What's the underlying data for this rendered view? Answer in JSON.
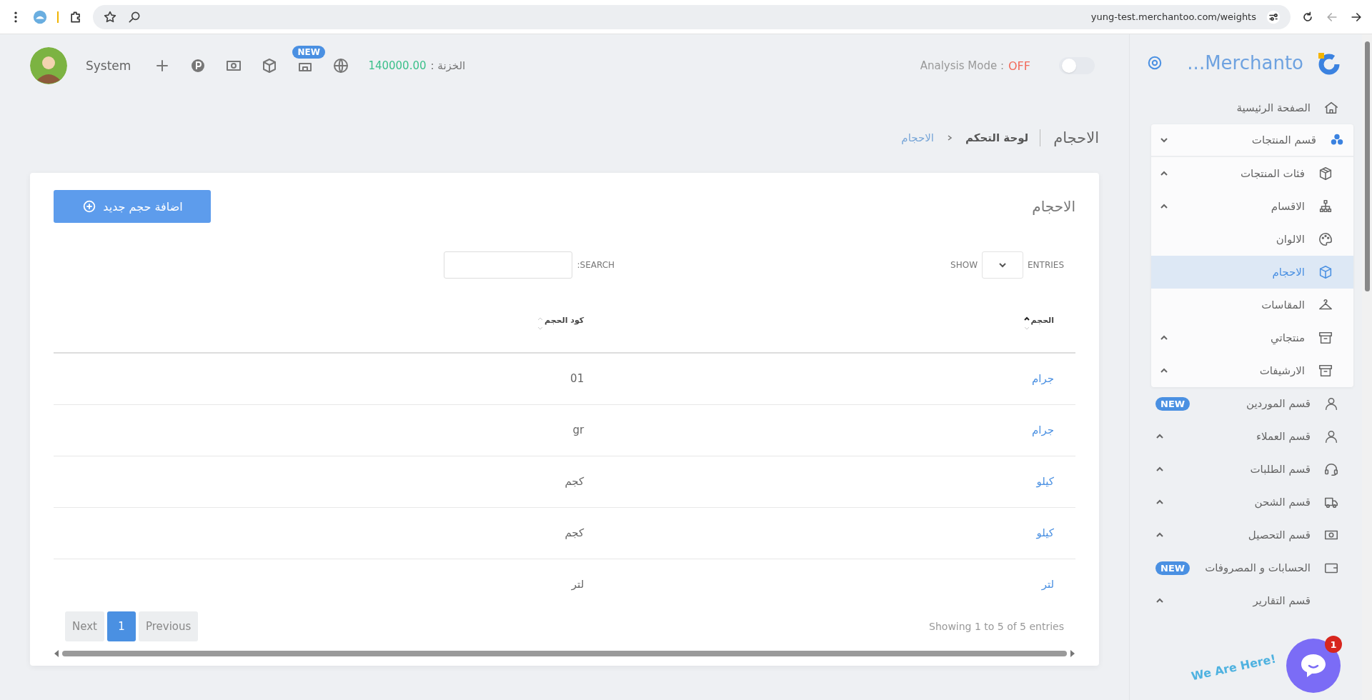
{
  "browser": {
    "url": "yung-test.merchantoo.com/weights"
  },
  "header": {
    "user_name": "System",
    "store_badge": "NEW",
    "treasury_label": "الخزنة :",
    "treasury_value": "140000.00",
    "analysis_label": "Analysis Mode :",
    "analysis_value": "OFF",
    "analysis_on": false
  },
  "sidebar": {
    "brand": "Merchanto...",
    "items": [
      {
        "kind": "link",
        "label": "الصفحة الرئيسية",
        "selected": false
      },
      {
        "kind": "group",
        "label": "قسم المنتجات",
        "expanded": true,
        "selected": false,
        "children": [
          {
            "kind": "group",
            "label": "فئات المنتجات",
            "expanded": false,
            "selected": false
          },
          {
            "kind": "group",
            "label": "الاقسام",
            "expanded": false,
            "selected": false
          },
          {
            "kind": "link",
            "label": "الالوان",
            "selected": false
          },
          {
            "kind": "link",
            "label": "الاحجام",
            "selected": true
          },
          {
            "kind": "link",
            "label": "المقاسات",
            "selected": false
          },
          {
            "kind": "group",
            "label": "منتجاتي",
            "expanded": false,
            "selected": false
          },
          {
            "kind": "group",
            "label": "الارشيفات",
            "expanded": false,
            "selected": false
          }
        ]
      },
      {
        "kind": "link",
        "label": "قسم الموردين",
        "badge": "NEW",
        "selected": false
      },
      {
        "kind": "group",
        "label": "قسم العملاء",
        "expanded": false,
        "selected": false
      },
      {
        "kind": "group",
        "label": "قسم الطلبات",
        "expanded": false,
        "selected": false
      },
      {
        "kind": "group",
        "label": "قسم الشحن",
        "expanded": false,
        "selected": false
      },
      {
        "kind": "group",
        "label": "قسم التحصيل",
        "expanded": false,
        "selected": false
      },
      {
        "kind": "link",
        "label": "الحسابات و المصروفات",
        "badge": "NEW",
        "selected": false
      },
      {
        "kind": "group",
        "label": "قسم التقارير",
        "expanded": false,
        "selected": false
      }
    ]
  },
  "breadcrumb": {
    "title": "الاحجام",
    "items": [
      {
        "label": "لوحة التحكم",
        "selected": false
      },
      {
        "label": "الاحجام",
        "selected": true
      }
    ]
  },
  "card": {
    "title": "الاحجام",
    "add_button": "اضافة حجم جديد",
    "show_label": "SHOW",
    "entries_label": "ENTRIES",
    "search_label": "SEARCH:",
    "table": {
      "columns": [
        {
          "label": "الحجم",
          "sorted": true
        },
        {
          "label": "كود الحجم",
          "sorted": false
        }
      ],
      "rows": [
        [
          "جرام",
          "01"
        ],
        [
          "جرام",
          "gr"
        ],
        [
          "كيلو",
          "كجم"
        ],
        [
          "كيلو",
          "كجم"
        ],
        [
          "لتر",
          "لتر"
        ]
      ]
    },
    "info": "Showing 1 to 5 of 5 entries",
    "pages": [
      {
        "label": "Previous",
        "selected": false
      },
      {
        "label": "1",
        "selected": true
      },
      {
        "label": "Next",
        "selected": false
      }
    ]
  },
  "chat": {
    "label": "We Are Here!",
    "badge": "1"
  }
}
